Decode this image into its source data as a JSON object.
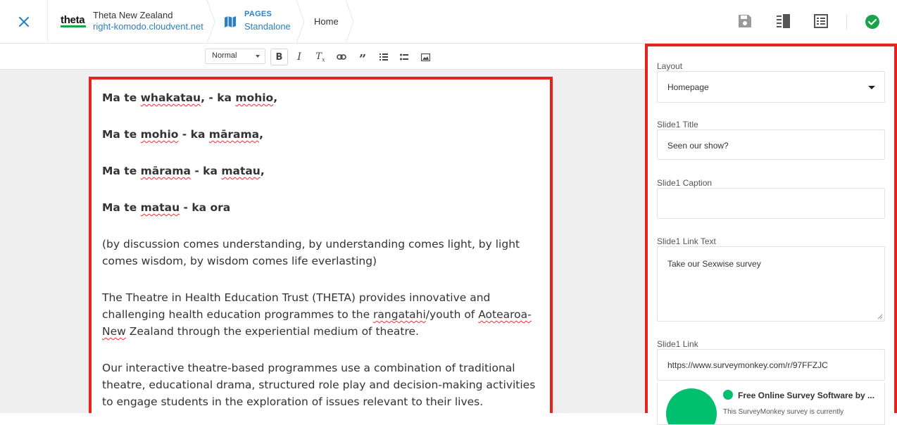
{
  "header": {
    "site_logo": "theta",
    "site_name": "Theta New Zealand",
    "site_url": "right-komodo.cloudvent.net",
    "pages_label": "PAGES",
    "pages_sub": "Standalone",
    "breadcrumb_current": "Home",
    "icons": [
      "close-icon",
      "save-icon",
      "split-view-icon",
      "form-view-icon",
      "check-circle-icon"
    ],
    "status_color": "#1aa34a"
  },
  "editor_toolbar": {
    "format_select": "Normal",
    "tools": [
      "bold",
      "italic",
      "clear-format",
      "link",
      "quote",
      "numbered-list",
      "bullet-list",
      "image"
    ]
  },
  "document": {
    "paragraphs": [
      {
        "bold": true,
        "parts": [
          {
            "t": "Ma te "
          },
          {
            "t": "whakatau",
            "sp": true
          },
          {
            "t": ", - ka "
          },
          {
            "t": "mohio",
            "sp": true
          },
          {
            "t": ","
          }
        ]
      },
      {
        "bold": true,
        "parts": [
          {
            "t": "Ma te "
          },
          {
            "t": "mohio",
            "sp": true
          },
          {
            "t": " - ka "
          },
          {
            "t": "mārama",
            "sp": true
          },
          {
            "t": ","
          }
        ]
      },
      {
        "bold": true,
        "parts": [
          {
            "t": "Ma te "
          },
          {
            "t": "mārama",
            "sp": true
          },
          {
            "t": " - ka "
          },
          {
            "t": "matau",
            "sp": true
          },
          {
            "t": ","
          }
        ]
      },
      {
        "bold": true,
        "parts": [
          {
            "t": "Ma te "
          },
          {
            "t": "matau",
            "sp": true
          },
          {
            "t": " - ka ora"
          }
        ]
      },
      {
        "bold": false,
        "parts": [
          {
            "t": "(by discussion comes understanding, by understanding comes light, by light comes wisdom, by wisdom comes life everlasting)"
          }
        ]
      },
      {
        "bold": false,
        "parts": [
          {
            "t": "The Theatre in Health Education Trust (THETA) provides innovative and challenging health education programmes to the "
          },
          {
            "t": "rangatahi",
            "sp": true
          },
          {
            "t": "/youth of "
          },
          {
            "t": "Aotearoa-New",
            "sp": true
          },
          {
            "t": " Zealand through the experiential medium of theatre."
          }
        ]
      },
      {
        "bold": false,
        "parts": [
          {
            "t": "Our interactive theatre-based programmes use a combination of traditional theatre, educational drama, structured role play and decision-making activities to engage students in the exploration of issues relevant to their lives."
          }
        ]
      }
    ]
  },
  "panel": {
    "layout_label": "Layout",
    "layout_value": "Homepage",
    "slide1_title_label": "Slide1 Title",
    "slide1_title_value": "Seen our show?",
    "slide1_caption_label": "Slide1 Caption",
    "slide1_caption_value": "",
    "slide1_link_text_label": "Slide1 Link Text",
    "slide1_link_text_value": "Take our Sexwise survey",
    "slide1_link_label": "Slide1 Link",
    "slide1_link_value": "https://www.surveymonkey.com/r/97FFZJC",
    "preview_title": "Free Online Survey Software by ...",
    "preview_text": "This SurveyMonkey survey is currently"
  }
}
